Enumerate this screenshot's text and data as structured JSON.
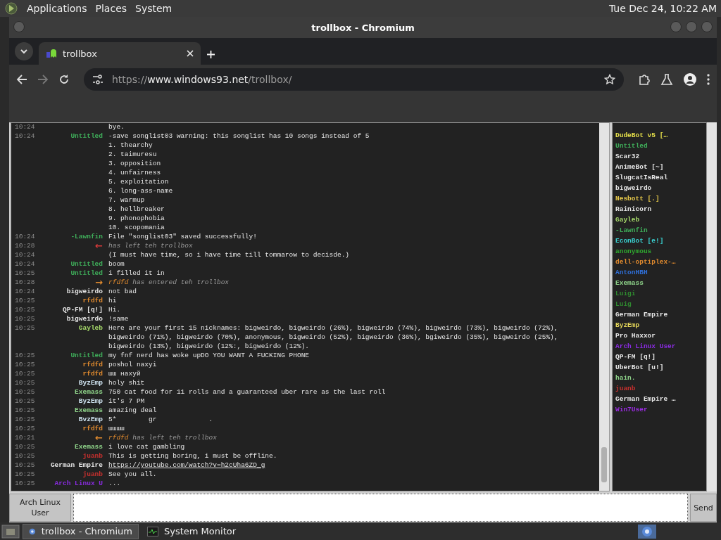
{
  "top_panel": {
    "menus": [
      "Applications",
      "Places",
      "System"
    ],
    "clock": "Tue Dec 24, 10:22 AM"
  },
  "window": {
    "title": "trollbox - Chromium"
  },
  "browser": {
    "tabs": [
      {
        "label": "trollbox",
        "selected": true
      }
    ],
    "url_parts": [
      {
        "text": "https://",
        "emphasis": false
      },
      {
        "text": "www.windows93.net",
        "emphasis": true
      },
      {
        "text": "/trollbox/",
        "emphasis": false
      }
    ]
  },
  "chat": {
    "messages": [
      {
        "kind": "message",
        "time": "10:24",
        "text": "bye."
      },
      {
        "kind": "message",
        "time": "10:24",
        "nick": "Untitled",
        "color": "#3fae5a",
        "text": "-save songlist03 warning: this songlist has 10 songs instead of 5",
        "continuation": [
          "1. thearchy",
          "2. taimuresu",
          "3. opposition",
          "4. unfairness",
          "5. exploitation",
          "6. long-ass-name",
          "7. warmup",
          "8. hellbreaker",
          "9. phonophobia",
          "10. scopomania"
        ]
      },
      {
        "kind": "message",
        "time": "10:24",
        "nick": "-Lawnfin",
        "color": "#3fae5a",
        "text": "File \"songlist03\" saved successfully!"
      },
      {
        "kind": "event",
        "time": "10:28",
        "arrow": "←",
        "color": "#d83a3a",
        "text": "has left teh trollbox"
      },
      {
        "kind": "message",
        "time": "10:24",
        "text": "(I must have time, so i have time till tommarow to decisde.)"
      },
      {
        "kind": "message",
        "time": "10:24",
        "nick": "Untitled",
        "color": "#3fae5a",
        "text": "boom"
      },
      {
        "kind": "message",
        "time": "10:25",
        "nick": "Untitled",
        "color": "#3fae5a",
        "text": "i filled it in"
      },
      {
        "kind": "event",
        "time": "10:28",
        "arrow": "→",
        "nick": "rfdfd",
        "color": "#e08a2e",
        "text": "has entered teh trollbox"
      },
      {
        "kind": "message",
        "time": "10:24",
        "nick": "bigweirdo",
        "color": "#e8e8e8",
        "text": "not bad"
      },
      {
        "kind": "message",
        "time": "10:25",
        "nick": "rfdfd",
        "color": "#e08a2e",
        "text": "hi"
      },
      {
        "kind": "message",
        "time": "10:25",
        "nick": "QP-FM [q!]",
        "color": "#e8e8e8",
        "text": "Hi."
      },
      {
        "kind": "message",
        "time": "10:25",
        "nick": "bigweirdo",
        "color": "#e8e8e8",
        "text": "!same"
      },
      {
        "kind": "message",
        "time": "10:25",
        "nick": "Gayleb",
        "color": "#a6d96a",
        "text": "Here are your first 15 nicknames: bigweirdo, bigweirdo (26%), bigweirdo (74%), bigweirdo (73%), bigweirdo (72%), bigweirdo (71%), bigweirdo (70%), anonymous, bigweirdo (52%), bigweirdo (36%), bgiweirdo (35%), bigweirdo (25%), bigweirdo (13%), bigweirdo (12%:, bigweirdo (12%)."
      },
      {
        "kind": "message",
        "time": "10:25",
        "nick": "Untitled",
        "color": "#3fae5a",
        "text": "my fnf nerd has woke upDO YOU WANT A FUCKING PHONE"
      },
      {
        "kind": "message",
        "time": "10:25",
        "nick": "rfdfd",
        "color": "#e08a2e",
        "text": "poshol naxyi"
      },
      {
        "kind": "message",
        "time": "10:25",
        "nick": "rfdfd",
        "color": "#e08a2e",
        "text": "шш нахуй"
      },
      {
        "kind": "message",
        "time": "10:25",
        "nick": "ByzEmp",
        "color": "#cfe3f0",
        "text": "holy shit"
      },
      {
        "kind": "message",
        "time": "10:25",
        "nick": "Exemass",
        "color": "#8fd48a",
        "text": "750 cat food for 11 rolls and a guaranteed uber rare as the last roll"
      },
      {
        "kind": "message",
        "time": "10:25",
        "nick": "ByzEmp",
        "color": "#cfe3f0",
        "text": "it's 7 PM"
      },
      {
        "kind": "message",
        "time": "10:25",
        "nick": "Exemass",
        "color": "#8fd48a",
        "text": "amazing deal"
      },
      {
        "kind": "message",
        "time": "10:25",
        "nick": "BvzEmp",
        "color": "#cfe3f0",
        "text": "5*        gr             ."
      },
      {
        "kind": "message",
        "time": "10:25",
        "nick": "rfdfd",
        "color": "#e08a2e",
        "text": "шшшш"
      },
      {
        "kind": "event",
        "time": "10:21",
        "arrow": "←",
        "nick": "rfdfd",
        "color": "#e08a2e",
        "text": "has left teh trollbox"
      },
      {
        "kind": "message",
        "time": "10:25",
        "nick": "Exemass",
        "color": "#8fd48a",
        "text": "i love cat gambling"
      },
      {
        "kind": "message",
        "time": "10:25",
        "nick": "juanb",
        "color": "#c8302e",
        "text": "This is getting boring, i must be offline."
      },
      {
        "kind": "message",
        "time": "10:25",
        "nick": "German Empire",
        "color": "#e8e8e8",
        "text": "https://youtube.com/watch?v=h2cUha6ZD_g",
        "link": true
      },
      {
        "kind": "message",
        "time": "10:25",
        "nick": "juanb",
        "color": "#c8302e",
        "text": "See you all."
      },
      {
        "kind": "message",
        "time": "10:25",
        "nick": "Arch Linux U",
        "color": "#8a2be2",
        "text": "..."
      }
    ]
  },
  "user_list": [
    {
      "name": "DudeBot  v5 […",
      "color": "#e6e04a"
    },
    {
      "name": "Untitled",
      "color": "#3fae5a"
    },
    {
      "name": "Scar32",
      "color": "#e8e8e8"
    },
    {
      "name": "AnimeBot [~]",
      "color": "#e8e8e8"
    },
    {
      "name": "SlugcatIsReal",
      "color": "#e8e8e8"
    },
    {
      "name": "bigweirdo",
      "color": "#e8e8e8"
    },
    {
      "name": "Nesbott [.]",
      "color": "#e6c84a"
    },
    {
      "name": "Rainicorn",
      "color": "#e8e8e8"
    },
    {
      "name": "Gayleb",
      "color": "#a6d96a"
    },
    {
      "name": "-Lawnfin",
      "color": "#3fae5a"
    },
    {
      "name": "EconBot [e!]",
      "color": "#3ad0d0"
    },
    {
      "name": "anonymous",
      "color": "#2fa82f"
    },
    {
      "name": "dell-optiplex-…",
      "color": "#e08a2e"
    },
    {
      "name": "AntonHBH",
      "color": "#2f6fd8"
    },
    {
      "name": "Exemass",
      "color": "#8fd48a"
    },
    {
      "name": "Luigi",
      "color": "#2f8a2f"
    },
    {
      "name": "Luig",
      "color": "#2f8a2f"
    },
    {
      "name": "German Empire",
      "color": "#e8e8e8"
    },
    {
      "name": "ByzEmp",
      "color": "#e6d85a"
    },
    {
      "name": "Pro Haxxor",
      "color": "#e8e8e8"
    },
    {
      "name": "Arch Linux User",
      "color": "#8a2be2"
    },
    {
      "name": "QP-FM [q!]",
      "color": "#e8e8e8"
    },
    {
      "name": "UberBot [u!]",
      "color": "#e8e8e8"
    },
    {
      "name": "hain.",
      "color": "#8fd48a"
    },
    {
      "name": "juanb",
      "color": "#c8302e"
    },
    {
      "name": "German Empire …",
      "color": "#e8e8e8"
    },
    {
      "name": "Win7User",
      "color": "#9a2be2"
    }
  ],
  "input_bar": {
    "sender": "Arch Linux User",
    "send": "Send"
  },
  "taskbar": {
    "items": [
      {
        "label": "trollbox - Chromium",
        "kind": "browser",
        "selected": true
      },
      {
        "label": "System Monitor",
        "kind": "monitor",
        "selected": false
      }
    ]
  }
}
